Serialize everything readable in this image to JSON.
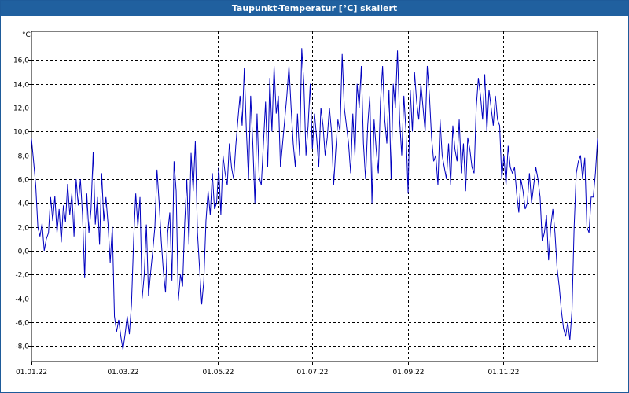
{
  "window": {
    "title": "Taupunkt-Temperatur [°C] skaliert"
  },
  "chart_data": {
    "type": "line",
    "title": "Taupunkt-Temperatur [°C] skaliert",
    "ylabel": "°C",
    "xlabel": "",
    "ylim": [
      -9.3,
      18.4
    ],
    "x_range": [
      "01.01.22",
      "31.12.22"
    ],
    "grid": true,
    "y_ticks": [
      -8,
      -6,
      -4,
      -2,
      0,
      2,
      4,
      6,
      8,
      10,
      12,
      14,
      16
    ],
    "y_tick_labels": [
      "-8,0",
      "-6,0",
      "-4,0",
      "-2,0",
      "0,0",
      "2,0",
      "4,0",
      "6,0",
      "8,0",
      "10,0",
      "12,0",
      "14,0",
      "16,0"
    ],
    "x_ticks": [
      {
        "day": 0,
        "label": "01.01.22"
      },
      {
        "day": 59,
        "label": "01.03.22"
      },
      {
        "day": 120,
        "label": "01.05.22"
      },
      {
        "day": 181,
        "label": "01.07.22"
      },
      {
        "day": 243,
        "label": "01.09.22"
      },
      {
        "day": 304,
        "label": "01.11.22"
      }
    ],
    "colors": {
      "line": "#0000c0",
      "grid": "#000000",
      "title_bar": "#20609f"
    },
    "series": [
      {
        "values": [
          9.4,
          7.5,
          5.5,
          2.0,
          1.2,
          2.3,
          0.0,
          1.0,
          1.5,
          4.5,
          2.5,
          4.6,
          1.5,
          3.5,
          0.7,
          3.8,
          2.4,
          5.6,
          3.0,
          4.8,
          1.2,
          6.0,
          3.8,
          6.0,
          3.0,
          -2.3,
          4.8,
          1.5,
          3.5,
          8.3,
          2.2,
          4.5,
          0.5,
          6.5,
          2.5,
          4.5,
          2.2,
          -1.0,
          2.0,
          -5.5,
          -6.8,
          -5.8,
          -7.2,
          -8.3,
          -7.0,
          -5.5,
          -7.0,
          -4.5,
          0.8,
          4.8,
          2.0,
          4.5,
          -4.0,
          -2.0,
          2.2,
          -3.8,
          -1.8,
          0.0,
          2.0,
          6.8,
          4.0,
          0.8,
          -1.8,
          -3.5,
          1.5,
          3.2,
          -2.5,
          7.5,
          5.0,
          -4.2,
          -2.0,
          -3.0,
          2.3,
          6.0,
          0.5,
          8.2,
          5.0,
          9.2,
          1.5,
          -1.5,
          -4.5,
          -2.5,
          2.5,
          5.0,
          3.0,
          6.5,
          3.5,
          4.0,
          7.0,
          3.0,
          8.0,
          6.5,
          5.5,
          9.0,
          7.0,
          6.0,
          8.8,
          11.0,
          13.0,
          10.5,
          15.3,
          10.0,
          6.0,
          13.0,
          9.0,
          4.0,
          11.5,
          6.2,
          5.5,
          9.0,
          12.5,
          7.0,
          14.5,
          10.0,
          15.5,
          11.5,
          13.0,
          7.0,
          9.0,
          11.0,
          13.0,
          15.5,
          12.0,
          9.0,
          7.0,
          11.5,
          8.0,
          17.0,
          14.0,
          8.0,
          10.5,
          14.0,
          8.5,
          11.5,
          9.5,
          7.0,
          12.0,
          10.5,
          8.0,
          9.5,
          12.0,
          10.0,
          5.5,
          8.5,
          11.0,
          10.0,
          16.5,
          12.0,
          10.5,
          9.0,
          6.5,
          11.5,
          8.0,
          14.0,
          12.0,
          15.5,
          9.0,
          6.0,
          10.5,
          13.0,
          4.0,
          11.0,
          8.5,
          6.5,
          12.5,
          15.5,
          11.0,
          9.0,
          13.5,
          6.0,
          14.0,
          12.0,
          16.8,
          11.0,
          8.0,
          13.0,
          10.0,
          4.8,
          13.5,
          10.0,
          15.0,
          12.5,
          11.0,
          14.0,
          12.0,
          10.0,
          15.5,
          13.0,
          9.5,
          7.5,
          8.0,
          5.5,
          11.0,
          8.0,
          7.0,
          6.0,
          9.0,
          5.5,
          10.5,
          8.5,
          7.5,
          11.0,
          6.5,
          9.0,
          5.0,
          9.5,
          8.5,
          7.0,
          6.5,
          12.0,
          14.5,
          13.0,
          11.0,
          14.8,
          10.0,
          13.5,
          12.0,
          10.5,
          13.0,
          11.0,
          10.5,
          6.0,
          8.0,
          5.5,
          8.8,
          7.0,
          6.5,
          7.0,
          4.8,
          3.2,
          6.0,
          5.0,
          3.5,
          4.0,
          6.5,
          4.0,
          5.5,
          7.0,
          6.0,
          4.5,
          0.8,
          1.5,
          3.0,
          -0.8,
          2.0,
          3.5,
          1.5,
          -1.5,
          -3.0,
          -5.0,
          -6.5,
          -7.2,
          -6.0,
          -7.5,
          -5.0,
          2.0,
          6.5,
          7.5,
          8.0,
          6.0,
          7.8,
          2.0,
          1.5,
          4.5,
          4.5,
          6.5,
          9.4
        ]
      }
    ]
  }
}
